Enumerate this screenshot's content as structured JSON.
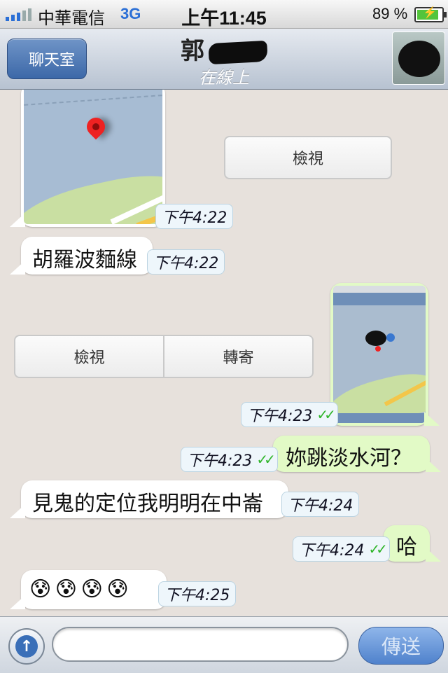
{
  "status_bar": {
    "carrier": "中華電信",
    "network": "3G",
    "time": "上午11:45",
    "battery": "89 %",
    "battery_level": 0.89
  },
  "header": {
    "back_label": "聊天室",
    "contact_name": "郭",
    "contact_status": "在線上"
  },
  "messages": [
    {
      "type": "location",
      "direction": "in",
      "time": "下午4:22",
      "action_label": "檢視"
    },
    {
      "type": "text",
      "direction": "in",
      "text": "胡羅波麵線",
      "time": "下午4:22"
    },
    {
      "type": "screenshot",
      "direction": "out",
      "time": "下午4:23",
      "delivered": true,
      "actions": [
        "檢視",
        "轉寄"
      ]
    },
    {
      "type": "text",
      "direction": "out",
      "text": "妳跳淡水河？",
      "time": "下午4:23",
      "delivered": true
    },
    {
      "type": "text",
      "direction": "in",
      "text": "見鬼的定位我明明在中崙",
      "time": "下午4:24"
    },
    {
      "type": "text",
      "direction": "out",
      "text": "哈",
      "time": "下午4:24",
      "delivered": true
    },
    {
      "type": "emoji",
      "direction": "in",
      "text": "😰 😰 😰 😰",
      "time": "下午4:25"
    }
  ],
  "input": {
    "placeholder": "",
    "send_label": "傳送",
    "attach_icon": "upload-arrow-icon"
  },
  "colors": {
    "incoming_bubble": "#ffffff",
    "outgoing_bubble": "#e2fac6",
    "chat_background": "#e7e1dc",
    "tick_color": "#2fb52a"
  }
}
